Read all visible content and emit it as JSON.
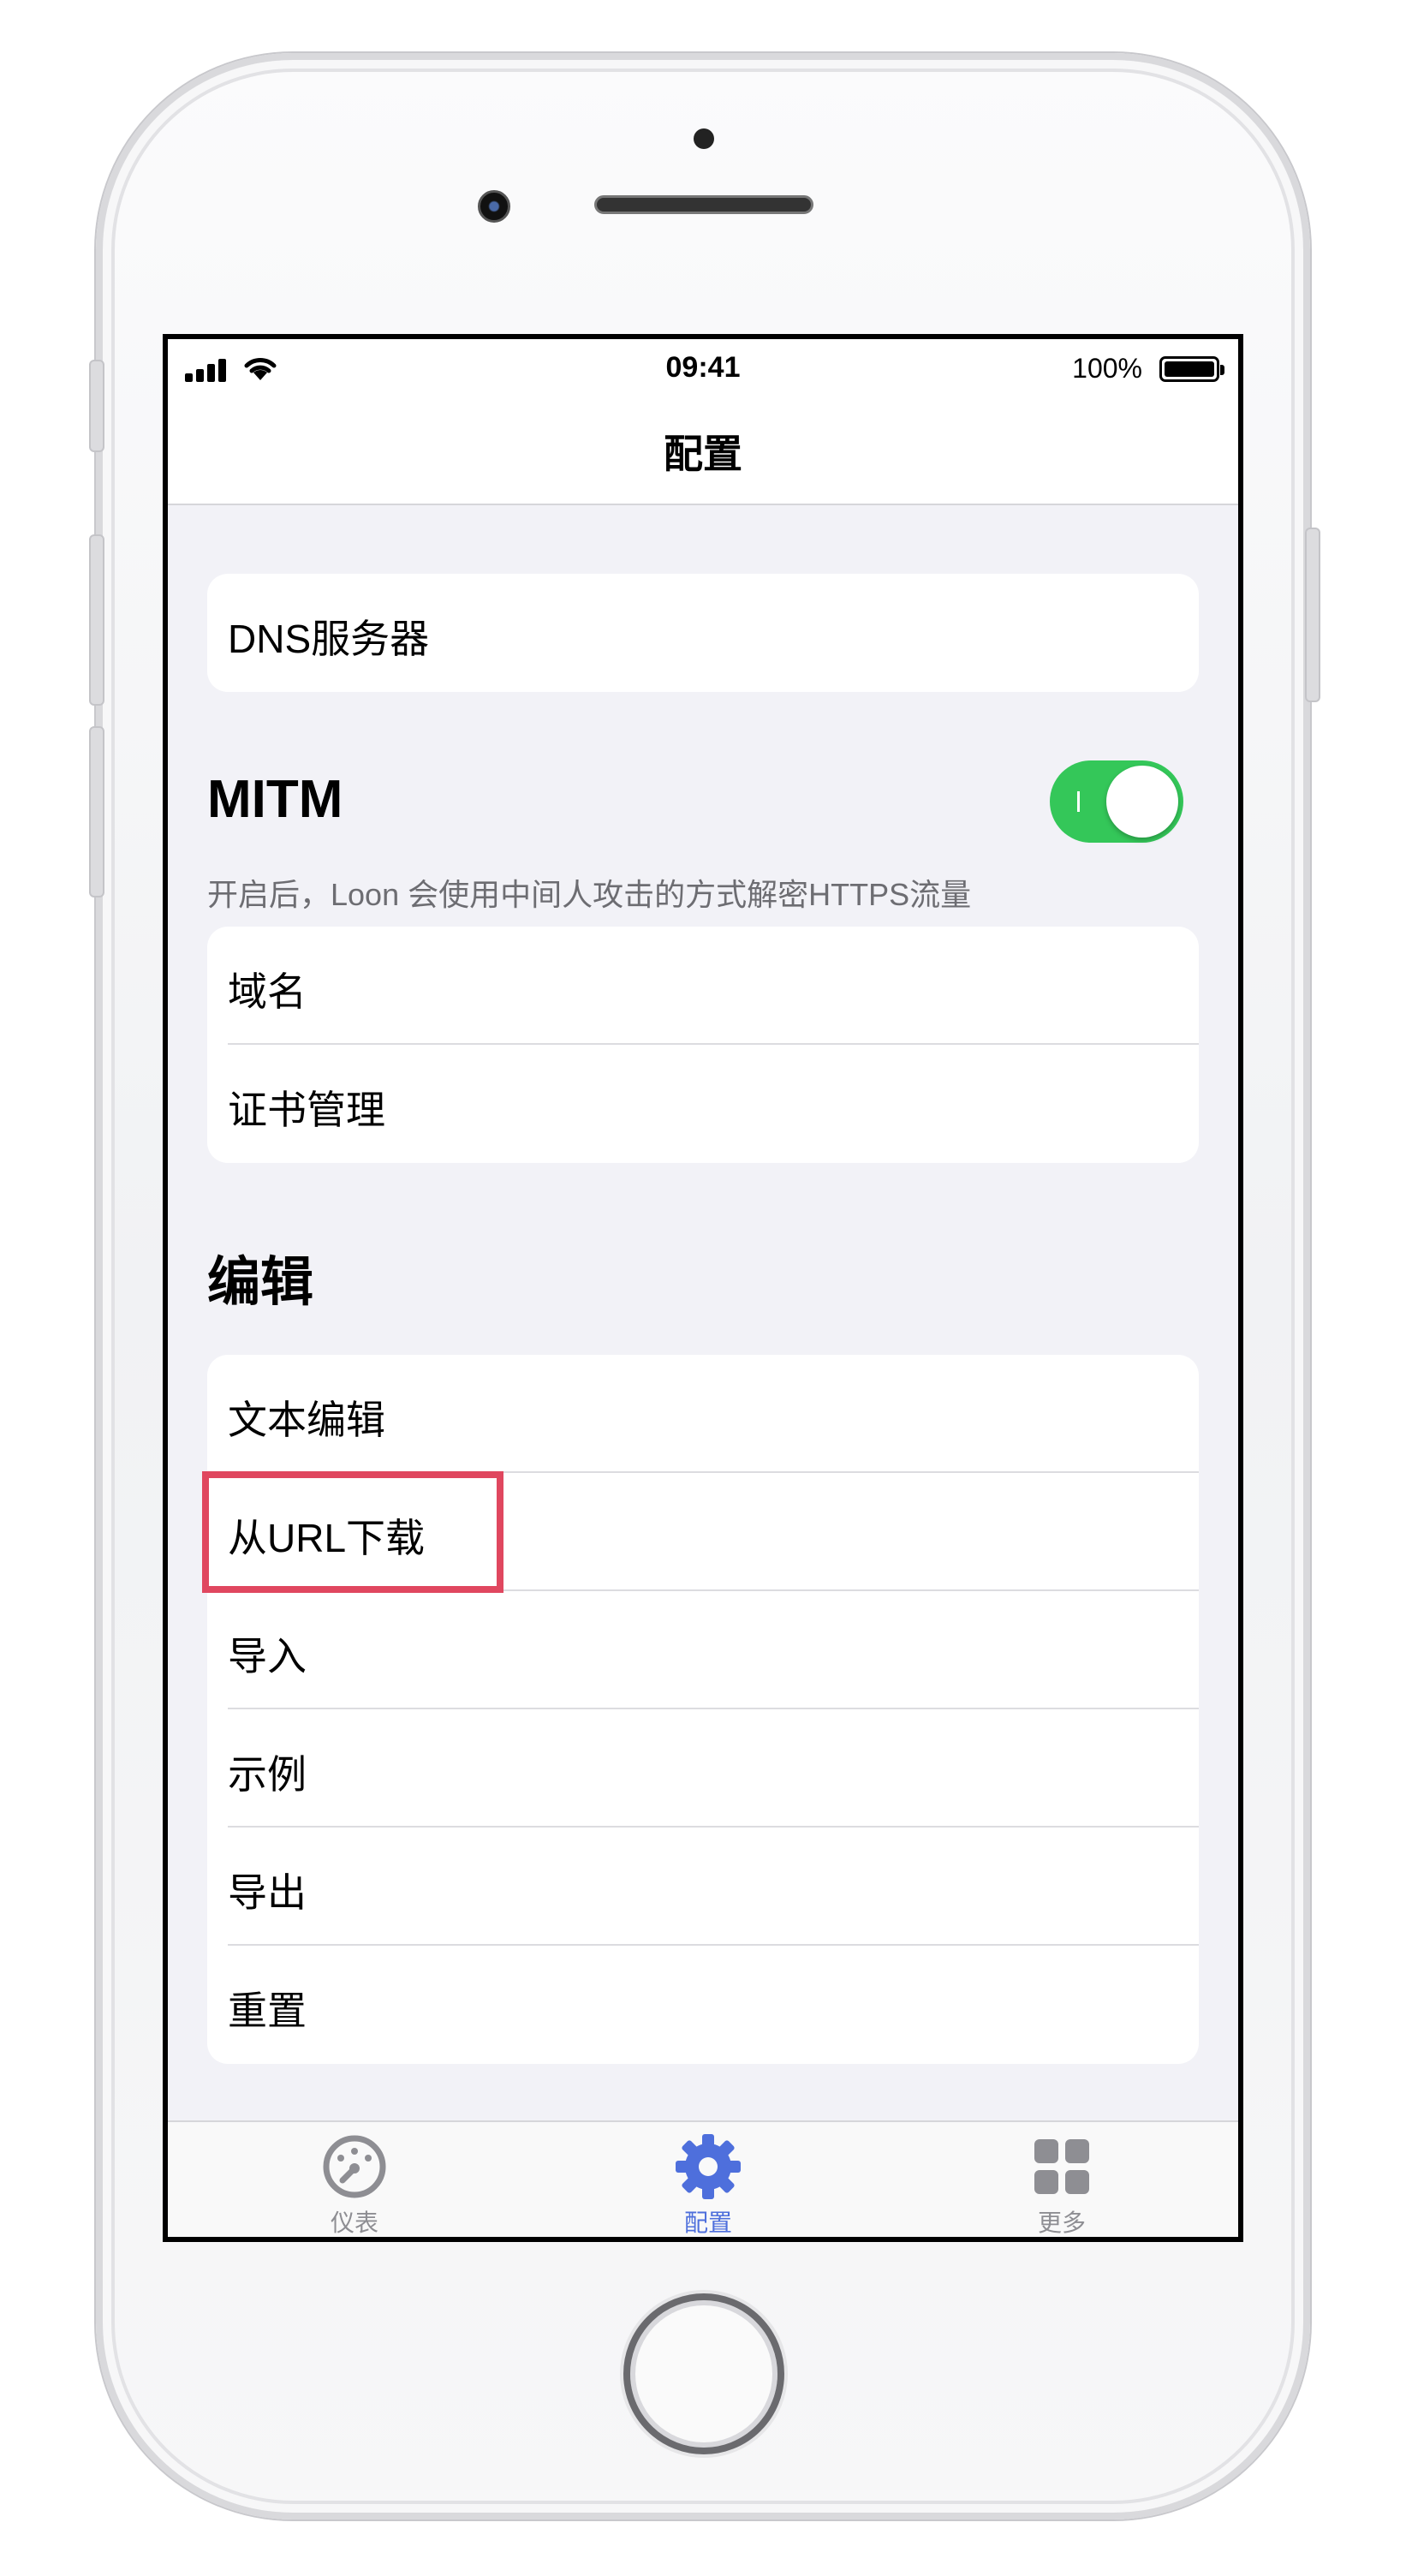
{
  "status_bar": {
    "time": "09:41",
    "battery": "100%"
  },
  "nav": {
    "title": "配置"
  },
  "dns": {
    "label": "DNS服务器"
  },
  "mitm": {
    "title": "MITM",
    "footer": "开启后，Loon 会使用中间人攻击的方式解密HTTPS流量",
    "toggle_on": true,
    "items": [
      {
        "label": "域名"
      },
      {
        "label": "证书管理"
      }
    ]
  },
  "edit": {
    "title": "编辑",
    "items": [
      {
        "label": "文本编辑"
      },
      {
        "label": "从URL下载"
      },
      {
        "label": "导入"
      },
      {
        "label": "示例"
      },
      {
        "label": "导出"
      },
      {
        "label": "重置"
      }
    ]
  },
  "tabs": [
    {
      "label": "仪表",
      "icon": "dashboard-icon",
      "active": false
    },
    {
      "label": "配置",
      "icon": "gear-icon",
      "active": true
    },
    {
      "label": "更多",
      "icon": "grid-icon",
      "active": false
    }
  ],
  "colors": {
    "accent": "#4e6fdc",
    "toggle_on": "#34c759",
    "highlight": "#e0475f",
    "inactive_tab": "#8e8e93"
  }
}
